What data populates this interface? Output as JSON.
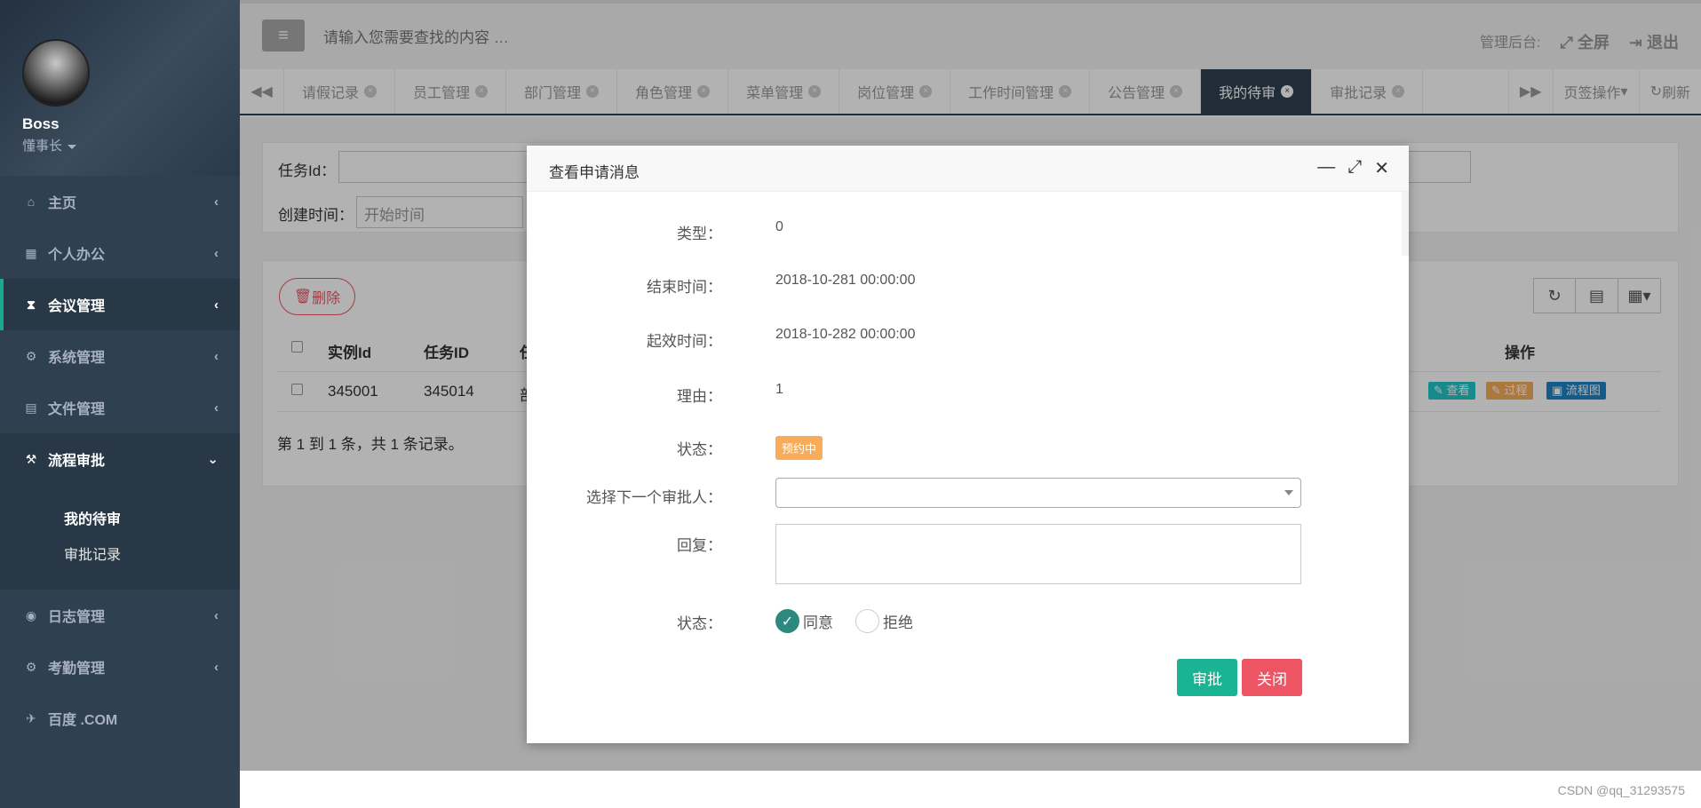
{
  "sidebar": {
    "user": {
      "name": "Boss",
      "role": "懂事长"
    },
    "items": [
      {
        "icon": "home-icon",
        "label": "主页"
      },
      {
        "icon": "calendar-icon",
        "label": "个人办公"
      },
      {
        "icon": "hourglass-icon",
        "label": "会议管理"
      },
      {
        "icon": "gear-icon",
        "label": "系统管理"
      },
      {
        "icon": "file-icon",
        "label": "文件管理"
      },
      {
        "icon": "gavel-icon",
        "label": "流程审批"
      },
      {
        "icon": "eye-icon",
        "label": "日志管理"
      },
      {
        "icon": "cogs-icon",
        "label": "考勤管理"
      },
      {
        "icon": "plane-icon",
        "label": "百度 .COM"
      }
    ],
    "sub_items": [
      "我的待审",
      "审批记录"
    ]
  },
  "topbar": {
    "search_placeholder": "请输入您需要查找的内容 …",
    "admin": "管理后台:",
    "fullscreen": "全屏",
    "logout": "退出"
  },
  "tabs": [
    "请假记录",
    "员工管理",
    "部门管理",
    "角色管理",
    "菜单管理",
    "岗位管理",
    "工作时间管理",
    "公告管理",
    "我的待审",
    "审批记录"
  ],
  "tab_actions": {
    "page_ops": "页签操作",
    "refresh": "刷新"
  },
  "filter": {
    "task_id_label": "任务Id：",
    "created_label": "创建时间：",
    "start_placeholder": "开始时间"
  },
  "toolbar": {
    "delete": "删除"
  },
  "table": {
    "headers": {
      "instance_id": "实例Id",
      "task_id": "任务ID",
      "partial": "任",
      "ops": "操作"
    },
    "row": {
      "instance_id": "345001",
      "task_id": "345014",
      "partial": "部"
    },
    "ops": {
      "view": "查看",
      "process": "过程",
      "flowchart": "流程图"
    },
    "footer": "第 1 到 1 条，共 1 条记录。"
  },
  "modal": {
    "title": "查看申请消息",
    "fields": {
      "type_label": "类型：",
      "type_value": "0",
      "end_label": "结束时间：",
      "end_value": "2018-10-281 00:00:00",
      "start_label": "起效时间：",
      "start_value": "2018-10-282 00:00:00",
      "reason_label": "理由：",
      "reason_value": "1",
      "status_label": "状态：",
      "status_badge": "预约中",
      "next_label": "选择下一个审批人：",
      "reply_label": "回复：",
      "decision_label": "状态：",
      "agree": "同意",
      "reject": "拒绝"
    },
    "approve": "审批",
    "close": "关闭"
  },
  "watermark": "CSDN @qq_31293575",
  "colors": {
    "sidebar": "#2f4050",
    "accent": "#19aa8d",
    "danger": "#ed5565",
    "warning": "#f8ac59",
    "info": "#23c6c8"
  }
}
